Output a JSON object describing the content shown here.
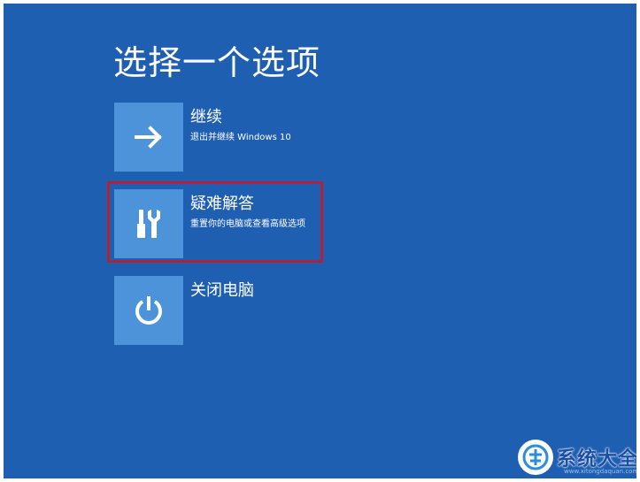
{
  "page": {
    "title": "选择一个选项"
  },
  "options": [
    {
      "title": "继续",
      "subtitle": "退出并继续 Windows 10",
      "icon": "arrow-right-icon"
    },
    {
      "title": "疑难解答",
      "subtitle": "重置你的电脑或查看高级选项",
      "icon": "tools-icon"
    },
    {
      "title": "关闭电脑",
      "subtitle": "",
      "icon": "power-icon"
    }
  ],
  "watermark": {
    "text": "系统大全",
    "url": "www.xitongdaquan.com"
  },
  "colors": {
    "background": "#1f5fb2",
    "tile": "#4d93d9",
    "highlight_border": "#b22234",
    "text": "#ffffff"
  }
}
